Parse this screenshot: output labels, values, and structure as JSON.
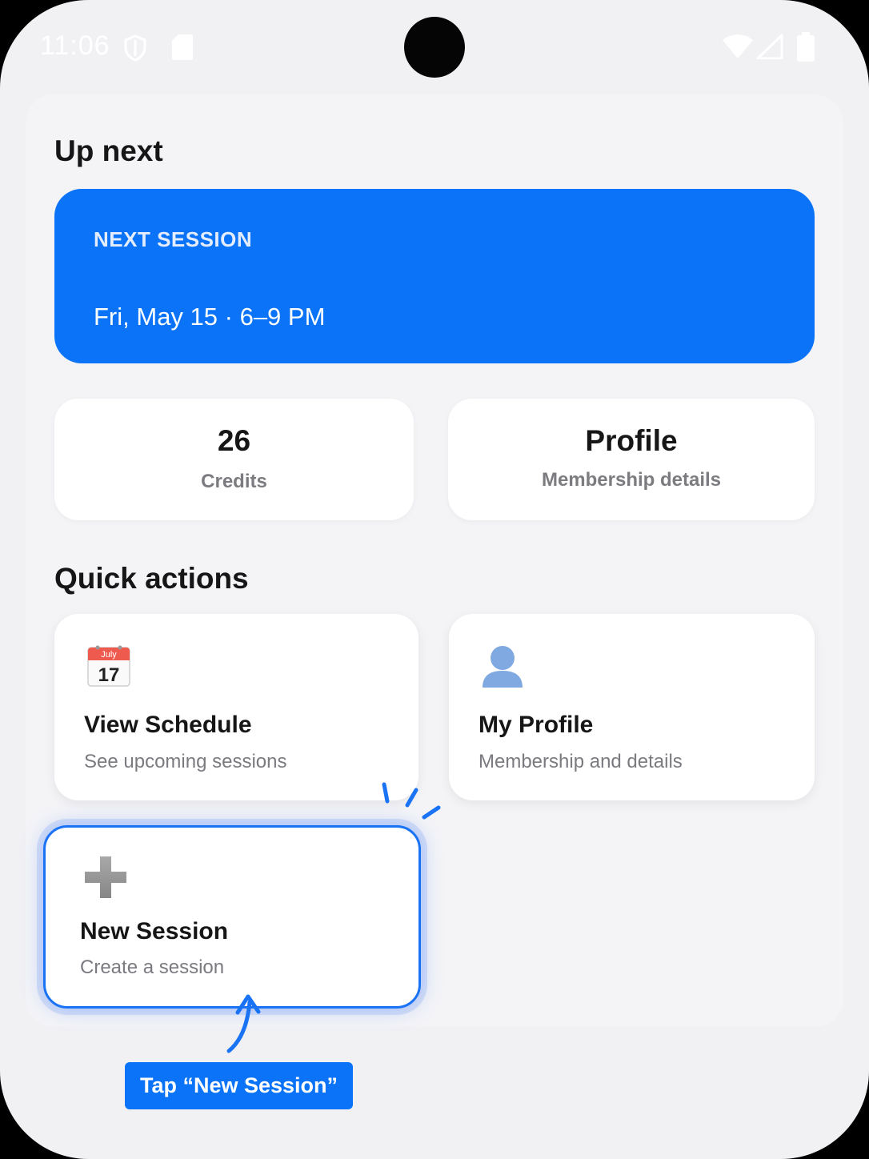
{
  "status_bar": {
    "time": "11:06"
  },
  "up_next": {
    "title": "Up next",
    "eyebrow": "NEXT SESSION",
    "when": "Fri, May 15 · 6–9 PM"
  },
  "stats": [
    {
      "value": "26",
      "label": "Credits"
    },
    {
      "value": "Profile",
      "label": "Membership details"
    }
  ],
  "quick_actions": {
    "title": "Quick actions",
    "items": [
      {
        "title": "View Schedule",
        "subtitle": "See upcoming sessions",
        "icon": "calendar-icon",
        "icon_month": "July",
        "icon_day": "17"
      },
      {
        "title": "My Profile",
        "subtitle": "Membership and details",
        "icon": "person-icon"
      },
      {
        "title": "New Session",
        "subtitle": "Create a session",
        "icon": "plus-icon"
      }
    ]
  },
  "hint": {
    "label": "Tap “New Session”"
  },
  "colors": {
    "accent": "#0a73f7",
    "background": "#f1f1f4",
    "card": "#ffffff"
  }
}
